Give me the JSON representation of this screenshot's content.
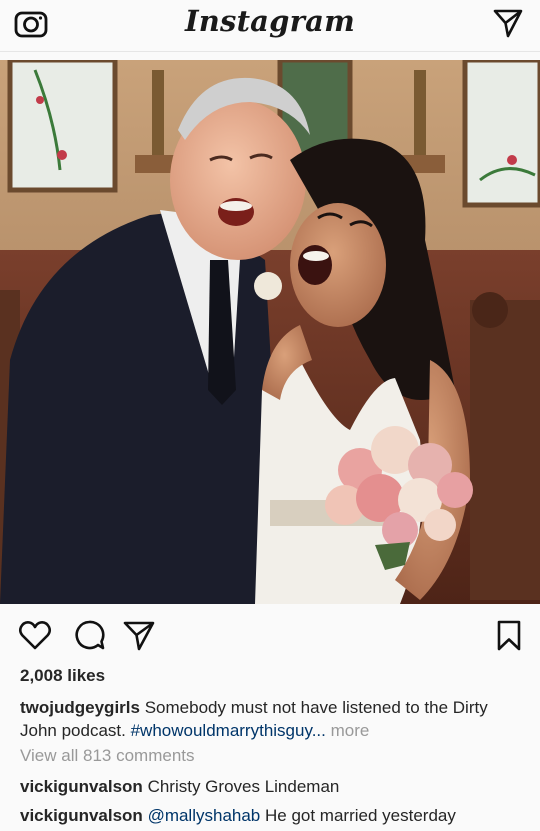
{
  "header": {
    "app_title": "Instagram",
    "left_icon": "camera-icon",
    "right_icon": "send-icon"
  },
  "post": {
    "photo_alt": "Wedding photo of couple",
    "actions": {
      "like_icon": "heart-icon",
      "comment_icon": "comment-icon",
      "share_icon": "share-icon",
      "save_icon": "bookmark-icon"
    },
    "likes": "2,008 likes",
    "caption": {
      "username": "twojudgeygirls",
      "text": "Somebody must not have listened to the Dirty John podcast.",
      "hashtag": "#whowouldmarrythisguy...",
      "more": "more"
    },
    "view_all_comments": "View all 813 comments",
    "comments": [
      {
        "username": "vickigunvalson",
        "mention": "",
        "text": "Christy Groves Lindeman"
      },
      {
        "username": "vickigunvalson",
        "mention": "@mallyshahab",
        "text": "He got married yesterday"
      }
    ]
  }
}
